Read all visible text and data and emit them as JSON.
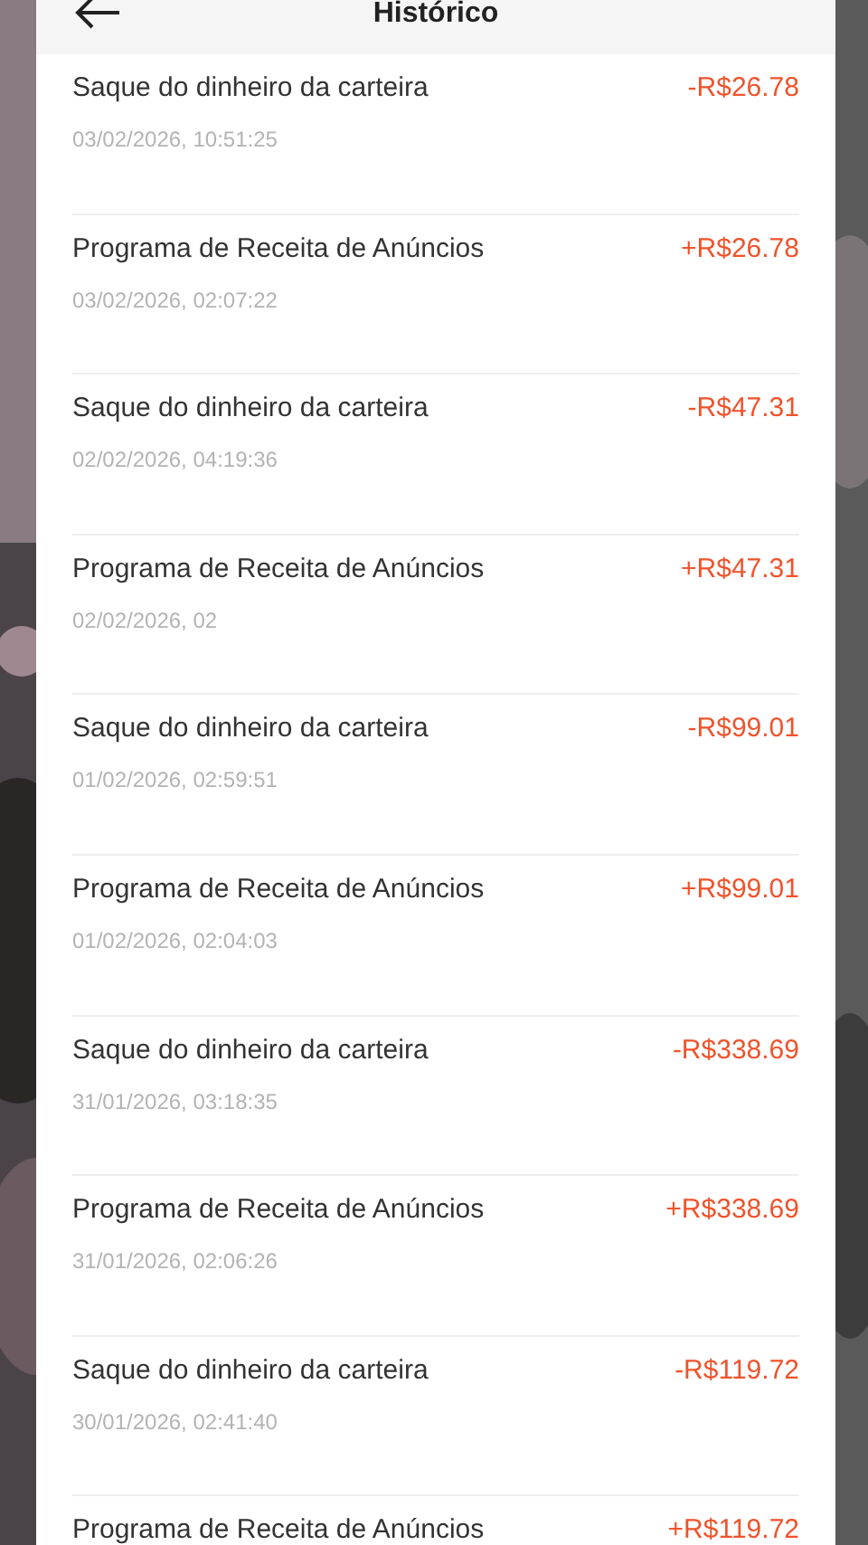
{
  "header": {
    "title": "Histórico"
  },
  "transactions": [
    {
      "title": "Saque do dinheiro da carteira",
      "date": "03/02/2026, 10:51:25",
      "amount": "-R$26.78"
    },
    {
      "title": "Programa de Receita de Anúncios",
      "date": "03/02/2026, 02:07:22",
      "amount": "+R$26.78"
    },
    {
      "title": "Saque do dinheiro da carteira",
      "date": "02/02/2026, 04:19:36",
      "amount": "-R$47.31"
    },
    {
      "title": "Programa de Receita de Anúncios",
      "date": "02/02/2026, 02",
      "amount": "+R$47.31"
    },
    {
      "title": "Saque do dinheiro da carteira",
      "date": "01/02/2026, 02:59:51",
      "amount": "-R$99.01"
    },
    {
      "title": "Programa de Receita de Anúncios",
      "date": "01/02/2026, 02:04:03",
      "amount": "+R$99.01"
    },
    {
      "title": "Saque do dinheiro da carteira",
      "date": "31/01/2026, 03:18:35",
      "amount": "-R$338.69"
    },
    {
      "title": "Programa de Receita de Anúncios",
      "date": "31/01/2026, 02:06:26",
      "amount": "+R$338.69"
    },
    {
      "title": "Saque do dinheiro da carteira",
      "date": "30/01/2026, 02:41:40",
      "amount": "-R$119.72"
    },
    {
      "title": "Programa de Receita de Anúncios",
      "amount": "+R$119.72"
    }
  ]
}
